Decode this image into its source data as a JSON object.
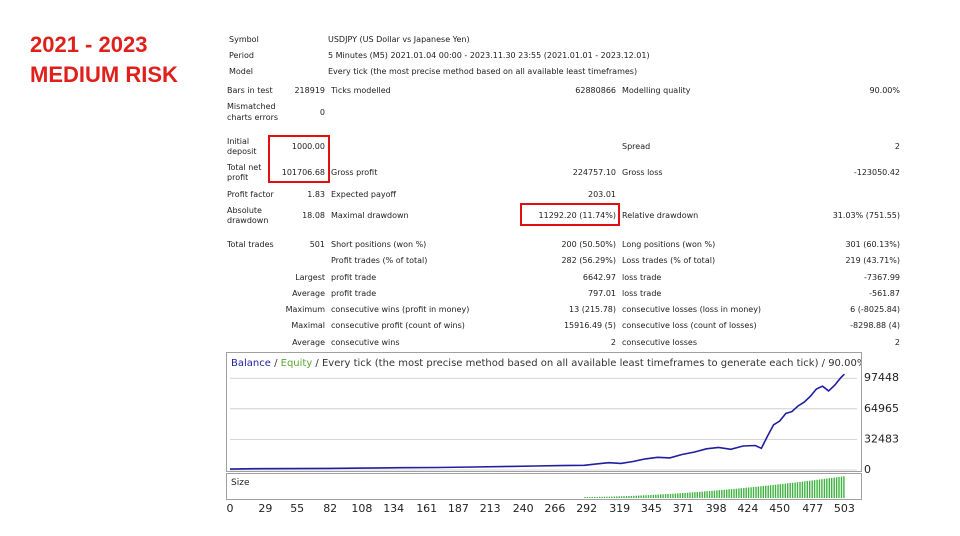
{
  "headline": {
    "line1": "2021 - 2023",
    "line2": "MEDIUM RISK"
  },
  "header": {
    "symbol": {
      "label": "Symbol",
      "value": "USDJPY (US Dollar vs Japanese Yen)"
    },
    "period": {
      "label": "Period",
      "value": "5 Minutes (M5) 2021.01.04 00:00 - 2023.11.30 23:55 (2021.01.01 - 2023.12.01)"
    },
    "model": {
      "label": "Model",
      "value": "Every tick (the most precise method based on all available least timeframes)"
    }
  },
  "stats": {
    "bars_label": "Bars in test",
    "bars_value": "218919",
    "ticks_label": "Ticks modelled",
    "ticks_value": "62880866",
    "quality_label": "Modelling quality",
    "quality_value": "90.00%",
    "mismatch_label_1": "Mismatched",
    "mismatch_label_2": "charts errors",
    "mismatch_value": "0",
    "deposit_label_1": "Initial",
    "deposit_label_2": "deposit",
    "deposit_value": "1000.00",
    "spread_label": "Spread",
    "spread_value": "2",
    "netprofit_label_1": "Total net",
    "netprofit_label_2": "profit",
    "netprofit_value": "101706.68",
    "grossprofit_label": "Gross profit",
    "grossprofit_value": "224757.10",
    "grossloss_label": "Gross loss",
    "grossloss_value": "-123050.42",
    "pf_label": "Profit factor",
    "pf_value": "1.83",
    "payoff_label": "Expected payoff",
    "payoff_value": "203.01",
    "absdd_label_1": "Absolute",
    "absdd_label_2": "drawdown",
    "absdd_value": "18.08",
    "maxdd_label": "Maximal drawdown",
    "maxdd_value": "11292.20 (11.74%)",
    "reldd_label": "Relative drawdown",
    "reldd_value": "31.03% (751.55)",
    "trades_label": "Total trades",
    "trades_value": "501",
    "short_label": "Short positions (won %)",
    "short_value": "200 (50.50%)",
    "long_label": "Long positions (won %)",
    "long_value": "301 (60.13%)",
    "profit_trades_label": "Profit trades (% of total)",
    "profit_trades_value": "282 (56.29%)",
    "loss_trades_label": "Loss trades (% of total)",
    "loss_trades_value": "219 (43.71%)",
    "largest_label": "Largest",
    "largest_profit_label": "profit trade",
    "largest_profit_value": "6642.97",
    "largest_loss_label": "loss trade",
    "largest_loss_value": "-7367.99",
    "average_label": "Average",
    "average_profit_label": "profit trade",
    "average_profit_value": "797.01",
    "average_loss_label": "loss trade",
    "average_loss_value": "-561.87",
    "maximum_label": "Maximum",
    "max_wins_label": "consecutive wins (profit in money)",
    "max_wins_value": "13 (215.78)",
    "max_losses_label": "consecutive losses (loss in money)",
    "max_losses_value": "6 (-8025.84)",
    "maximal_label": "Maximal",
    "maximal_profit_label": "consecutive profit (count of wins)",
    "maximal_profit_value": "15916.49 (5)",
    "maximal_loss_label": "consecutive loss (count of losses)",
    "maximal_loss_value": "-8298.88 (4)",
    "avg_consec_label": "Average",
    "avg_wins_label": "consecutive wins",
    "avg_wins_value": "2",
    "avg_losses_label": "consecutive losses",
    "avg_losses_value": "2"
  },
  "chart_data": {
    "type": "line",
    "legend": {
      "balance": "Balance",
      "equity": "Equity",
      "sep": " / ",
      "rest": " / Every tick (the most precise method based on all available least timeframes to generate each tick) / 90.00%"
    },
    "size_label": "Size",
    "colors": {
      "balance": "#1f1fa0",
      "equity": "#5aa832",
      "size": "#3fb33f",
      "grid": "#c8c8c8",
      "headline": "#e0201b",
      "highlight": "#e01010"
    },
    "ylim": [
      0,
      103000
    ],
    "xlim": [
      0,
      510
    ],
    "y_ticks": [
      "0",
      "32483",
      "64965",
      "97448"
    ],
    "x_ticks": [
      "0",
      "29",
      "55",
      "82",
      "108",
      "134",
      "161",
      "187",
      "213",
      "240",
      "266",
      "292",
      "319",
      "345",
      "371",
      "398",
      "424",
      "450",
      "477",
      "503"
    ],
    "series": [
      {
        "name": "Balance",
        "x": [
          0,
          20,
          50,
          80,
          110,
          140,
          170,
          200,
          230,
          250,
          270,
          290,
          300,
          310,
          320,
          330,
          340,
          350,
          360,
          370,
          380,
          390,
          400,
          410,
          420,
          430,
          435,
          440,
          445,
          450,
          455,
          460,
          465,
          470,
          475,
          480,
          485,
          490,
          495,
          500,
          503
        ],
        "y": [
          1000,
          1400,
          1500,
          1700,
          2000,
          2400,
          2700,
          3200,
          3800,
          4200,
          4700,
          5000,
          6500,
          7800,
          7000,
          9000,
          11800,
          13500,
          12800,
          16500,
          19000,
          22500,
          24000,
          22000,
          25500,
          26000,
          23000,
          36000,
          48000,
          52000,
          60000,
          62000,
          68000,
          72000,
          78000,
          86000,
          89000,
          84000,
          90000,
          98000,
          101706
        ]
      }
    ],
    "size_bars": {
      "start_x": 290,
      "end_x": 503,
      "min": 0.05,
      "max": 0.95
    }
  }
}
